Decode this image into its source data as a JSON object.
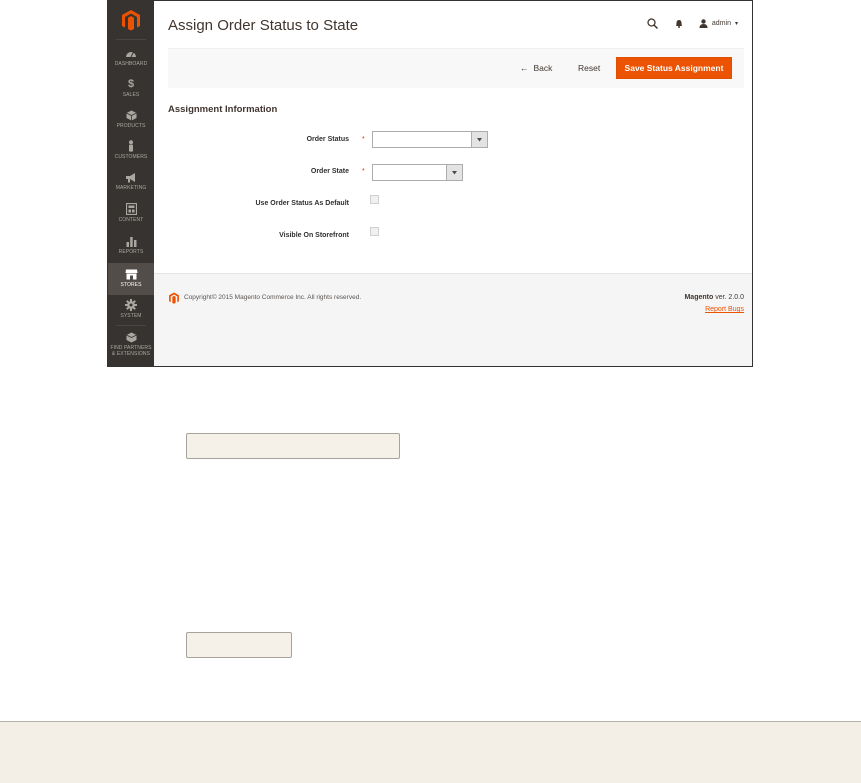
{
  "sidebar": {
    "items": [
      {
        "label": "DASHBOARD",
        "icon": "dashboard-icon"
      },
      {
        "label": "SALES",
        "icon": "dollar-icon"
      },
      {
        "label": "PRODUCTS",
        "icon": "box-icon"
      },
      {
        "label": "CUSTOMERS",
        "icon": "person-icon"
      },
      {
        "label": "MARKETING",
        "icon": "megaphone-icon"
      },
      {
        "label": "CONTENT",
        "icon": "content-icon"
      },
      {
        "label": "REPORTS",
        "icon": "bar-chart-icon"
      },
      {
        "label": "STORES",
        "icon": "store-icon"
      },
      {
        "label": "SYSTEM",
        "icon": "gear-icon"
      },
      {
        "label": "FIND PARTNERS & EXTENSIONS",
        "icon": "extensions-icon"
      }
    ],
    "active_index": 7
  },
  "header": {
    "title": "Assign Order Status to State",
    "account_name": "admin"
  },
  "toolbar": {
    "back_label": "Back",
    "reset_label": "Reset",
    "save_label": "Save Status Assignment"
  },
  "form": {
    "section_title": "Assignment Information",
    "order_status_label": "Order Status",
    "order_status_value": "",
    "order_state_label": "Order State",
    "order_state_value": "",
    "use_default_label": "Use Order Status As Default",
    "visible_label": "Visible On Storefront",
    "required_mark": "*"
  },
  "footer": {
    "copyright": "Copyright© 2015 Magento Commerce Inc. All rights reserved.",
    "brand": "Magento",
    "version": "ver. 2.0.0",
    "report_bugs": "Report Bugs"
  },
  "colors": {
    "accent": "#eb5202",
    "sidebar_bg": "#373330",
    "callout_bg": "#f5f1e9"
  }
}
